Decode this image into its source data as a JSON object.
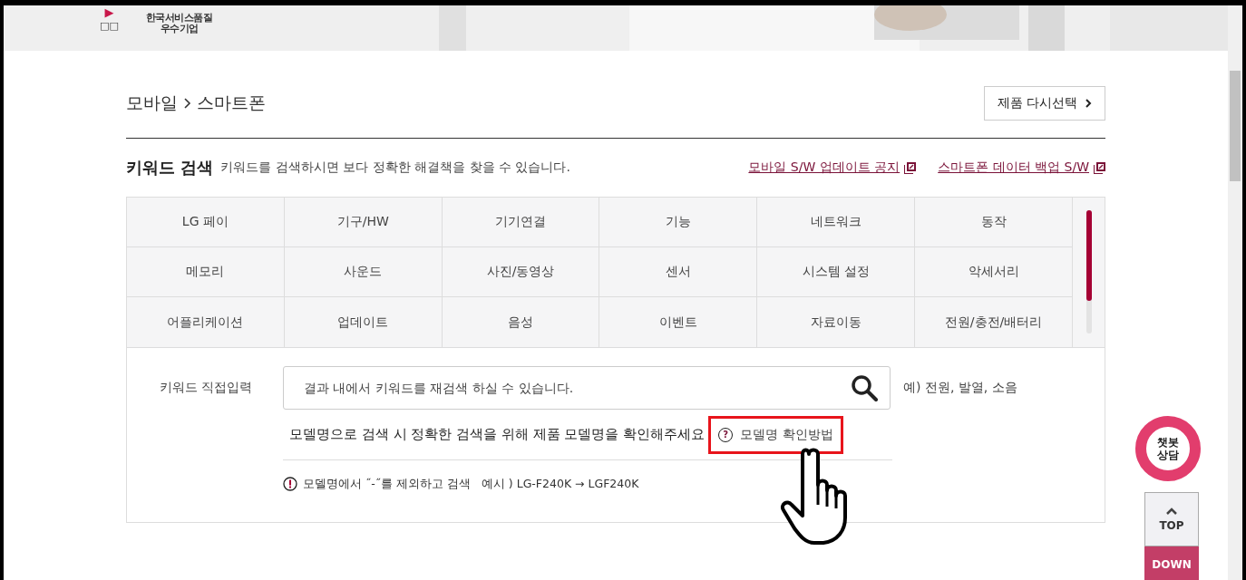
{
  "banner": {
    "play": "▶",
    "glyphs": "□□",
    "award": "한국서비스품질\n우수기업"
  },
  "breadcrumb": {
    "items": [
      "모바일",
      "스마트폰"
    ]
  },
  "reselect_button": "제품 다시선택",
  "keyword": {
    "title": "키워드 검색",
    "description": "키워드를 검색하시면 보다 정확한 해결책을 찾을 수 있습니다.",
    "links": [
      "모바일 S/W 업데이트 공지",
      "스마트폰 데이터 백업 S/W"
    ]
  },
  "categories": [
    "LG 페이",
    "기구/HW",
    "기기연결",
    "기능",
    "네트워크",
    "동작",
    "메모리",
    "사운드",
    "사진/동영상",
    "센서",
    "시스템 설정",
    "악세서리",
    "어플리케이션",
    "업데이트",
    "음성",
    "이벤트",
    "자료이동",
    "전원/충전/배터리"
  ],
  "direct_input": {
    "label": "키워드 직접입력",
    "placeholder": "결과 내에서 키워드를 재검색 하실 수 있습니다.",
    "example": "예) 전원, 발열, 소음"
  },
  "model_notice": {
    "text": "모델명으로 검색 시 정확한 검색을 위해 제품 모델명을 확인해주세요",
    "help_mark": "?",
    "link": "모델명 확인방법",
    "highlighted": true,
    "tip": "모델명에서 ˝-˝를 제외하고 검색   예시 ) LG-F240K → LGF240K"
  },
  "chatbot": "챗봇\n상담",
  "scroll_buttons": [
    "TOP",
    "DOWN"
  ]
}
